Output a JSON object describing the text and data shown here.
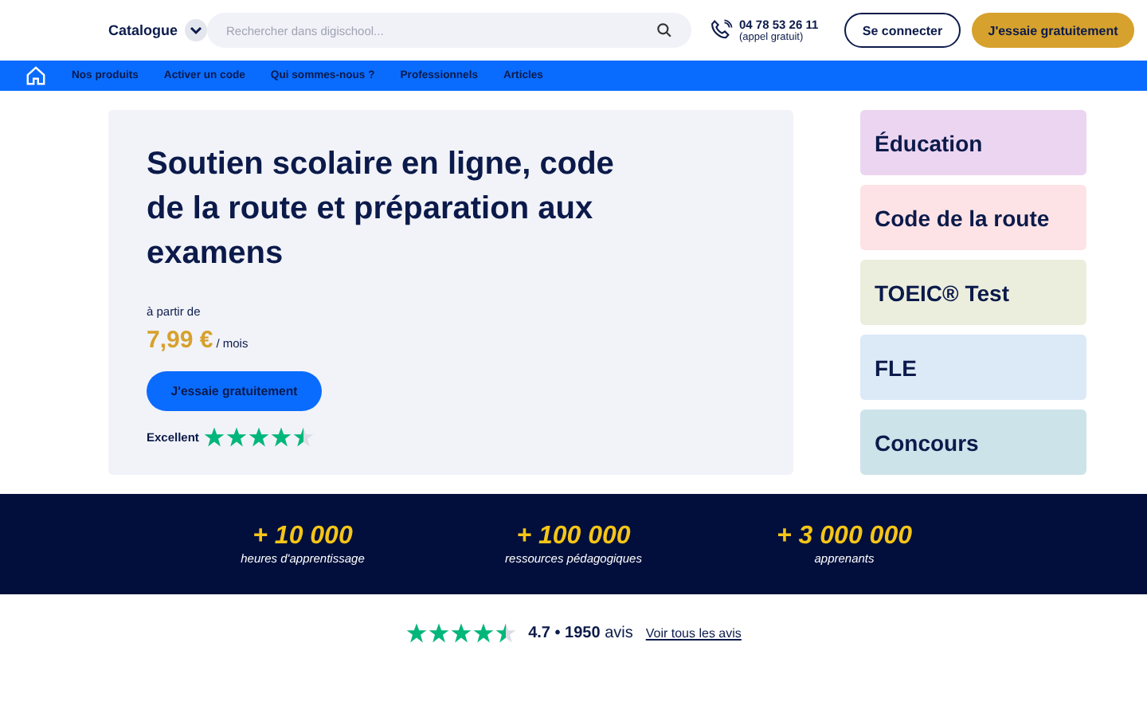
{
  "header": {
    "catalogue": "Catalogue",
    "search": {
      "placeholder": "Rechercher dans digischool..."
    },
    "phone": "04 78 53 26 11",
    "phone_note": "(appel gratuit)",
    "login": "Se connecter",
    "cta": "J'essaie gratuitement"
  },
  "nav": [
    "Nos produits",
    "Activer un code",
    "Qui sommes-nous ?",
    "Professionnels",
    "Articles"
  ],
  "hero": {
    "title": "Soutien scolaire en ligne, code de la route et préparation aux examens",
    "from": "à partir de",
    "price": "7,99 €",
    "period": "/ mois",
    "cta": "J'essaie gratuitement",
    "rating_label": "Excellent",
    "stars": 4.5
  },
  "categories": [
    {
      "label": "Éducation",
      "color": "#ecd5f0"
    },
    {
      "label": "Code de la route",
      "color": "#fde3e6"
    },
    {
      "label": "TOEIC® Test",
      "color": "#eceedd"
    },
    {
      "label": "FLE",
      "color": "#dce9f7"
    },
    {
      "label": "Concours",
      "color": "#cde3ea"
    }
  ],
  "stats": [
    {
      "value": "+ 10 000",
      "label": "heures d'apprentissage"
    },
    {
      "value": "+ 100 000",
      "label": "ressources pédagogiques"
    },
    {
      "value": "+ 3 000 000",
      "label": "apprenants"
    }
  ],
  "reviews": {
    "stars": 4.5,
    "score": "4.7 • 1950",
    "unit": "avis",
    "link": "Voir tous les avis"
  }
}
